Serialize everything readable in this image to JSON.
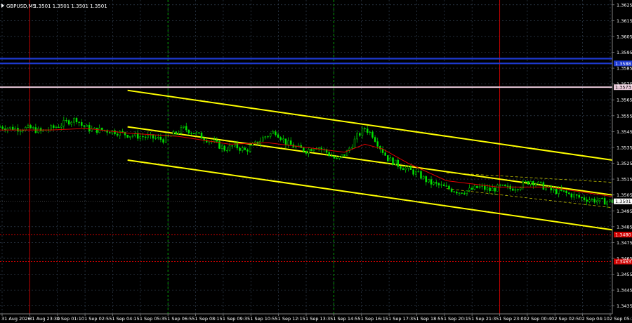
{
  "header": {
    "symbol": "GBPUSD,M5",
    "ohlc": "1.3501 1.3501 1.3501 1.3501"
  },
  "colors": {
    "background": "#000000",
    "grid": "#3a4a5e",
    "candle": "#00e000",
    "ma": "#e00000",
    "channel": "#ffff00",
    "channel_small": "#bfbf00",
    "session_line": "#c00000",
    "day_separator": "#00cc00",
    "resistance_blue": "#1e3ad0",
    "level_red": "#d00000",
    "level_pink": "#e8c8d8",
    "axis_text": "#ffffff"
  },
  "chart_data": {
    "type": "candlestick",
    "symbol": "GBPUSD",
    "timeframe": "M5",
    "ylim": [
      1.343,
      1.3628
    ],
    "y_ticks": [
      "1.3625",
      "1.3615",
      "1.3605",
      "1.3595",
      "1.3585",
      "1.3575",
      "1.3565",
      "1.3555",
      "1.3545",
      "1.3535",
      "1.3525",
      "1.3515",
      "1.3505",
      "1.3495",
      "1.3485",
      "1.3475",
      "1.3465",
      "1.3455",
      "1.3445",
      "1.3435"
    ],
    "x_ticks": [
      "31 Aug 2026",
      "31 Aug 23:30",
      "1 Sep 01:10",
      "1 Sep 02:55",
      "1 Sep 04:15",
      "1 Sep 05:35",
      "1 Sep 06:55",
      "1 Sep 08:15",
      "1 Sep 09:35",
      "1 Sep 10:55",
      "1 Sep 12:15",
      "1 Sep 13:35",
      "1 Sep 14:55",
      "1 Sep 16:15",
      "1 Sep 17:35",
      "1 Sep 18:55",
      "1 Sep 20:15",
      "1 Sep 21:35",
      "1 Sep 23:00",
      "2 Sep 00:40",
      "2 Sep 02:50",
      "2 Sep 04:10",
      "2 Sep 05:30"
    ],
    "close_path": [
      [
        0,
        1.3548
      ],
      [
        5,
        1.3547
      ],
      [
        12,
        1.3547
      ],
      [
        16,
        1.3545
      ],
      [
        22,
        1.3548
      ],
      [
        26,
        1.3551
      ],
      [
        30,
        1.3553
      ],
      [
        32,
        1.3549
      ],
      [
        36,
        1.3546
      ],
      [
        40,
        1.3546
      ],
      [
        45,
        1.3545
      ],
      [
        50,
        1.3543
      ],
      [
        55,
        1.3542
      ],
      [
        60,
        1.3541
      ],
      [
        64,
        1.354
      ],
      [
        68,
        1.3543
      ],
      [
        72,
        1.3547
      ],
      [
        75,
        1.3545
      ],
      [
        80,
        1.3541
      ],
      [
        84,
        1.3538
      ],
      [
        88,
        1.3534
      ],
      [
        92,
        1.3536
      ],
      [
        96,
        1.3533
      ],
      [
        100,
        1.3537
      ],
      [
        104,
        1.3542
      ],
      [
        108,
        1.3545
      ],
      [
        112,
        1.3538
      ],
      [
        116,
        1.3535
      ],
      [
        120,
        1.3533
      ],
      [
        124,
        1.3536
      ],
      [
        128,
        1.3532
      ],
      [
        132,
        1.3527
      ],
      [
        136,
        1.3532
      ],
      [
        140,
        1.3542
      ],
      [
        143,
        1.3547
      ],
      [
        146,
        1.3543
      ],
      [
        149,
        1.3535
      ],
      [
        152,
        1.3528
      ],
      [
        156,
        1.3524
      ],
      [
        160,
        1.3521
      ],
      [
        164,
        1.3518
      ],
      [
        168,
        1.3513
      ],
      [
        172,
        1.3511
      ],
      [
        176,
        1.3509
      ],
      [
        180,
        1.3507
      ],
      [
        184,
        1.3508
      ],
      [
        188,
        1.351
      ],
      [
        192,
        1.3508
      ],
      [
        196,
        1.351
      ],
      [
        200,
        1.3509
      ],
      [
        204,
        1.3511
      ],
      [
        208,
        1.3514
      ],
      [
        212,
        1.3511
      ],
      [
        216,
        1.3508
      ],
      [
        220,
        1.3507
      ],
      [
        224,
        1.3505
      ],
      [
        228,
        1.3503
      ],
      [
        232,
        1.3502
      ],
      [
        236,
        1.3501
      ],
      [
        240,
        1.3501
      ]
    ],
    "ma_path": [
      [
        0,
        1.3546
      ],
      [
        20,
        1.3546
      ],
      [
        34,
        1.3547
      ],
      [
        50,
        1.3544
      ],
      [
        70,
        1.3542
      ],
      [
        90,
        1.3537
      ],
      [
        105,
        1.3538
      ],
      [
        120,
        1.3535
      ],
      [
        135,
        1.3532
      ],
      [
        143,
        1.3537
      ],
      [
        150,
        1.3534
      ],
      [
        160,
        1.3525
      ],
      [
        175,
        1.3514
      ],
      [
        195,
        1.351
      ],
      [
        215,
        1.351
      ],
      [
        240,
        1.3504
      ]
    ],
    "x_max": 240,
    "channel_main": {
      "upper": [
        [
          50,
          1.3571
        ],
        [
          240,
          1.3527
        ]
      ],
      "middle": [
        [
          50,
          1.3548
        ],
        [
          240,
          1.3505
        ]
      ],
      "lower": [
        [
          50,
          1.3527
        ],
        [
          240,
          1.3483
        ]
      ]
    },
    "channel_small": {
      "upper": [
        [
          175,
          1.3519
        ],
        [
          240,
          1.3513
        ]
      ],
      "lower": [
        [
          175,
          1.3509
        ],
        [
          240,
          1.3497
        ]
      ]
    },
    "horizontal_levels": [
      {
        "name": "resistance-1",
        "value": 1.3588,
        "label": "1.3588",
        "color": "#1e3ad0"
      },
      {
        "name": "resistance-2",
        "value": 1.3591,
        "label": "",
        "color": "#1e3ad0"
      },
      {
        "name": "level-1573",
        "value": 1.3573,
        "label": "1.3573",
        "color": "#e8c8d8"
      },
      {
        "name": "level-1480",
        "value": 1.348,
        "label": "1.3480",
        "color": "#d00000"
      },
      {
        "name": "level-1463",
        "value": 1.3463,
        "label": "1.3463",
        "color": "#d00000"
      }
    ],
    "current_price": {
      "value": 1.3501,
      "label": "1.3501"
    },
    "vertical_lines": [
      {
        "name": "session-start-line",
        "tick": 1,
        "color": "#c00000",
        "style": "solid"
      },
      {
        "name": "day-separator-1",
        "tick": 6,
        "color": "#00cc00",
        "style": "dashed"
      },
      {
        "name": "day-separator-2",
        "tick": 12,
        "color": "#00cc00",
        "style": "dashed"
      },
      {
        "name": "session-end-line",
        "tick": 18,
        "color": "#c00000",
        "style": "solid"
      }
    ],
    "grid": true
  }
}
